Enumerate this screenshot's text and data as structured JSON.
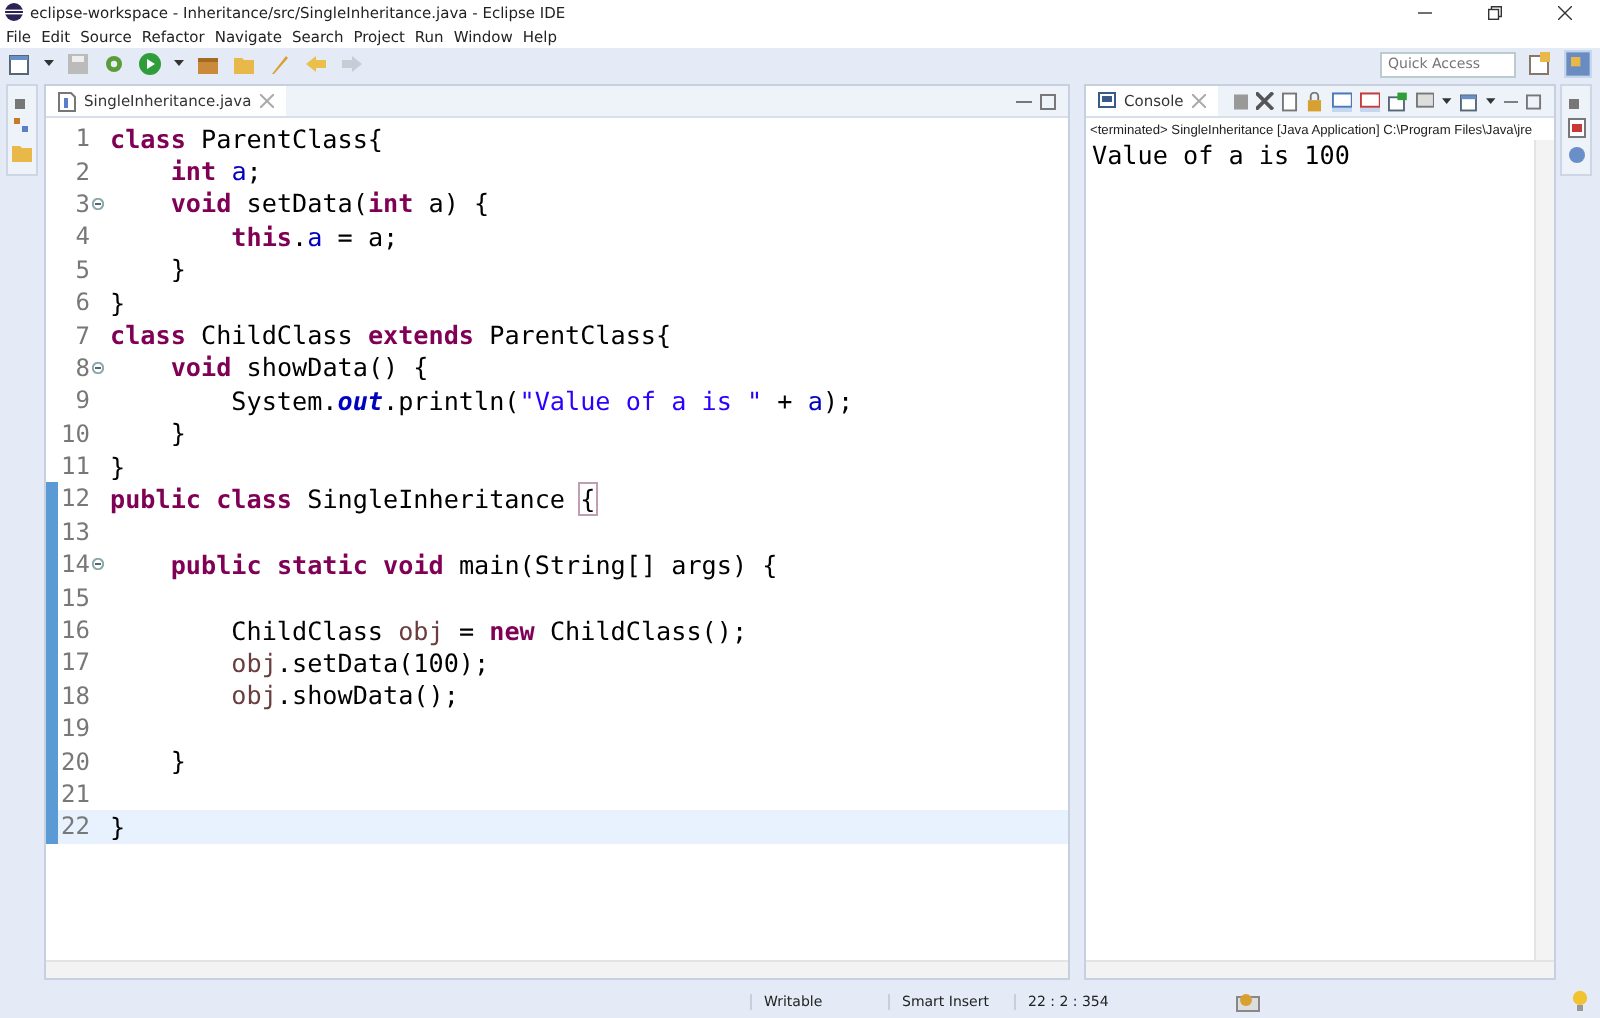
{
  "window": {
    "title": "eclipse-workspace - Inheritance/src/SingleInheritance.java - Eclipse IDE"
  },
  "menu": [
    "File",
    "Edit",
    "Source",
    "Refactor",
    "Navigate",
    "Search",
    "Project",
    "Run",
    "Window",
    "Help"
  ],
  "quick_access": {
    "placeholder": "Quick Access"
  },
  "editor": {
    "tabs": [
      {
        "label": "SingleInheritance.java",
        "selected": true
      }
    ],
    "lines": [
      {
        "number": "1",
        "folding": false,
        "in_range": false,
        "current": false,
        "tokens": [
          {
            "kind": "keyword",
            "text": "class"
          },
          {
            "kind": "plain",
            "text": " ParentClass{"
          }
        ]
      },
      {
        "number": "2",
        "folding": false,
        "in_range": false,
        "current": false,
        "tokens": [
          {
            "kind": "keyword",
            "text": "    int"
          },
          {
            "kind": "field",
            "text": " a"
          },
          {
            "kind": "plain",
            "text": ";"
          }
        ]
      },
      {
        "number": "3",
        "folding": true,
        "in_range": false,
        "current": false,
        "tokens": [
          {
            "kind": "keyword",
            "text": "    void"
          },
          {
            "kind": "plain",
            "text": " setData("
          },
          {
            "kind": "keyword",
            "text": "int"
          },
          {
            "kind": "plain",
            "text": " a) {"
          }
        ]
      },
      {
        "number": "4",
        "folding": false,
        "in_range": false,
        "current": false,
        "tokens": [
          {
            "kind": "keyword",
            "text": "        this"
          },
          {
            "kind": "plain",
            "text": "."
          },
          {
            "kind": "field",
            "text": "a"
          },
          {
            "kind": "plain",
            "text": " = a;"
          }
        ]
      },
      {
        "number": "5",
        "folding": false,
        "in_range": false,
        "current": false,
        "tokens": [
          {
            "kind": "plain",
            "text": "    }"
          }
        ]
      },
      {
        "number": "6",
        "folding": false,
        "in_range": false,
        "current": false,
        "tokens": [
          {
            "kind": "plain",
            "text": "}"
          }
        ]
      },
      {
        "number": "7",
        "folding": false,
        "in_range": false,
        "current": false,
        "tokens": [
          {
            "kind": "keyword",
            "text": "class"
          },
          {
            "kind": "plain",
            "text": " ChildClass "
          },
          {
            "kind": "keyword",
            "text": "extends"
          },
          {
            "kind": "plain",
            "text": " ParentClass{"
          }
        ]
      },
      {
        "number": "8",
        "folding": true,
        "in_range": false,
        "current": false,
        "tokens": [
          {
            "kind": "keyword",
            "text": "    void"
          },
          {
            "kind": "plain",
            "text": " showData() {"
          }
        ]
      },
      {
        "number": "9",
        "folding": false,
        "in_range": false,
        "current": false,
        "tokens": [
          {
            "kind": "plain",
            "text": "        System."
          },
          {
            "kind": "static",
            "text": "out"
          },
          {
            "kind": "plain",
            "text": ".println("
          },
          {
            "kind": "string",
            "text": "\"Value of a is \""
          },
          {
            "kind": "plain",
            "text": " + "
          },
          {
            "kind": "field",
            "text": "a"
          },
          {
            "kind": "plain",
            "text": ");"
          }
        ]
      },
      {
        "number": "10",
        "folding": false,
        "in_range": false,
        "current": false,
        "tokens": [
          {
            "kind": "plain",
            "text": "    }"
          }
        ]
      },
      {
        "number": "11",
        "folding": false,
        "in_range": false,
        "current": false,
        "tokens": [
          {
            "kind": "plain",
            "text": "}"
          }
        ]
      },
      {
        "number": "12",
        "folding": false,
        "in_range": true,
        "current": false,
        "tokens": [
          {
            "kind": "keyword",
            "text": "public"
          },
          {
            "kind": "keyword",
            "text": " class"
          },
          {
            "kind": "plain",
            "text": " SingleInheritance "
          },
          {
            "kind": "bracket",
            "text": "{"
          }
        ]
      },
      {
        "number": "13",
        "folding": false,
        "in_range": true,
        "current": false
      },
      {
        "number": "14",
        "folding": true,
        "in_range": true,
        "current": false,
        "tokens": [
          {
            "kind": "keyword",
            "text": "    public"
          },
          {
            "kind": "keyword",
            "text": " static"
          },
          {
            "kind": "keyword",
            "text": " void"
          },
          {
            "kind": "plain",
            "text": " main(String[] args) {"
          }
        ]
      },
      {
        "number": "15",
        "folding": false,
        "in_range": true,
        "current": false
      },
      {
        "number": "16",
        "folding": false,
        "in_range": true,
        "current": false,
        "tokens": [
          {
            "kind": "plain",
            "text": "        ChildClass "
          },
          {
            "kind": "local",
            "text": "obj"
          },
          {
            "kind": "plain",
            "text": " = "
          },
          {
            "kind": "keyword",
            "text": "new"
          },
          {
            "kind": "plain",
            "text": " ChildClass();"
          }
        ]
      },
      {
        "number": "17",
        "folding": false,
        "in_range": true,
        "current": false,
        "tokens": [
          {
            "kind": "local",
            "text": "        obj"
          },
          {
            "kind": "plain",
            "text": ".setData(100);"
          }
        ]
      },
      {
        "number": "18",
        "folding": false,
        "in_range": true,
        "current": false,
        "tokens": [
          {
            "kind": "local",
            "text": "        obj"
          },
          {
            "kind": "plain",
            "text": ".showData();"
          }
        ]
      },
      {
        "number": "19",
        "folding": false,
        "in_range": true,
        "current": false
      },
      {
        "number": "20",
        "folding": false,
        "in_range": true,
        "current": false,
        "tokens": [
          {
            "kind": "plain",
            "text": "    }"
          }
        ]
      },
      {
        "number": "21",
        "folding": false,
        "in_range": true,
        "current": false
      },
      {
        "number": "22",
        "folding": false,
        "in_range": true,
        "current": true,
        "tokens": [
          {
            "kind": "plain",
            "text": "}"
          }
        ]
      }
    ]
  },
  "console": {
    "tabs": [
      {
        "label": "Console",
        "selected": true
      }
    ],
    "header": "<terminated> SingleInheritance [Java Application] C:\\Program Files\\Java\\jre",
    "output": [
      "Value of a is 100"
    ]
  },
  "status_bar": [
    "Writable",
    "Smart Insert",
    "22 : 2 : 354"
  ]
}
